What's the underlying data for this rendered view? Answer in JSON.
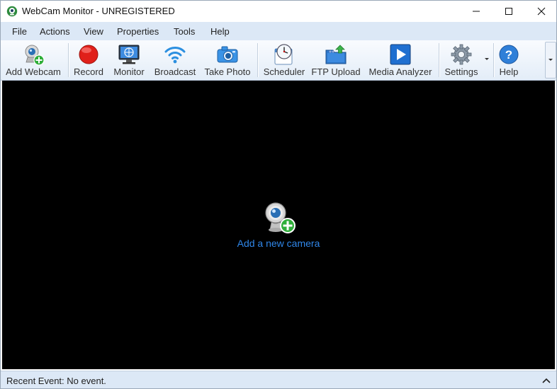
{
  "window": {
    "title": "WebCam Monitor - UNREGISTERED"
  },
  "menu": [
    "File",
    "Actions",
    "View",
    "Properties",
    "Tools",
    "Help"
  ],
  "toolbar": {
    "add_webcam": "Add Webcam",
    "record": "Record",
    "monitor": "Monitor",
    "broadcast": "Broadcast",
    "take_photo": "Take Photo",
    "scheduler": "Scheduler",
    "ftp_upload": "FTP Upload",
    "media_analyzer": "Media Analyzer",
    "settings": "Settings",
    "help": "Help"
  },
  "main": {
    "add_camera_link": "Add a new camera"
  },
  "status": {
    "text": "Recent Event: No event."
  },
  "colors": {
    "accent": "#2f86e8",
    "menubar": "#dce8f6",
    "record": "#e0201a",
    "plus_green": "#2fae3a"
  }
}
